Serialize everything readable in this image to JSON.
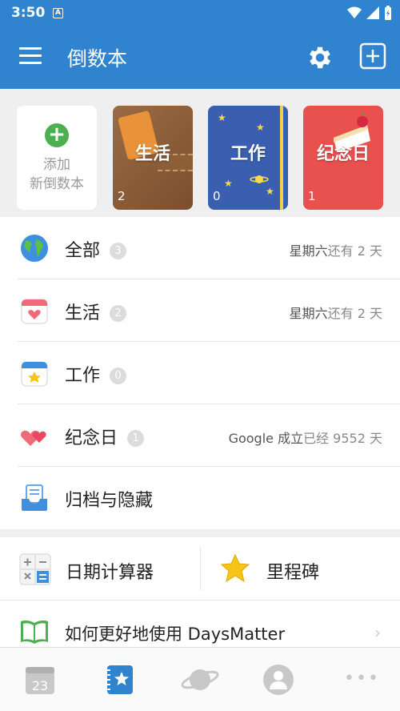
{
  "status_bar": {
    "time": "3:50",
    "badge": "A"
  },
  "app_bar": {
    "title": "倒数本"
  },
  "books": {
    "add": {
      "line1": "添加",
      "line2": "新倒数本"
    },
    "items": [
      {
        "name": "生活",
        "count": "2"
      },
      {
        "name": "工作",
        "count": "0"
      },
      {
        "name": "纪念日",
        "count": "1"
      }
    ]
  },
  "list": {
    "items": [
      {
        "label": "全部",
        "badge": "3",
        "right_prefix": "星期六",
        "right_suffix": "还有 2 天"
      },
      {
        "label": "生活",
        "badge": "2",
        "right_prefix": "星期六",
        "right_suffix": "还有 2 天"
      },
      {
        "label": "工作",
        "badge": "0"
      },
      {
        "label": "纪念日",
        "badge": "1",
        "right_prefix": "Google 成立",
        "right_suffix": "已经 9552 天"
      },
      {
        "label": "归档与隐藏"
      }
    ]
  },
  "tools": {
    "calculator": "日期计算器",
    "milestone": "里程碑"
  },
  "help": {
    "label": "如何更好地使用 DaysMatter",
    "chevron": "›"
  },
  "nav": {
    "calendar_day": "23",
    "more": "•••"
  },
  "colors": {
    "primary": "#2f83cf",
    "add_green": "#4caf50",
    "work_blue": "#3b5fb0",
    "memo_red": "#e9514f"
  }
}
